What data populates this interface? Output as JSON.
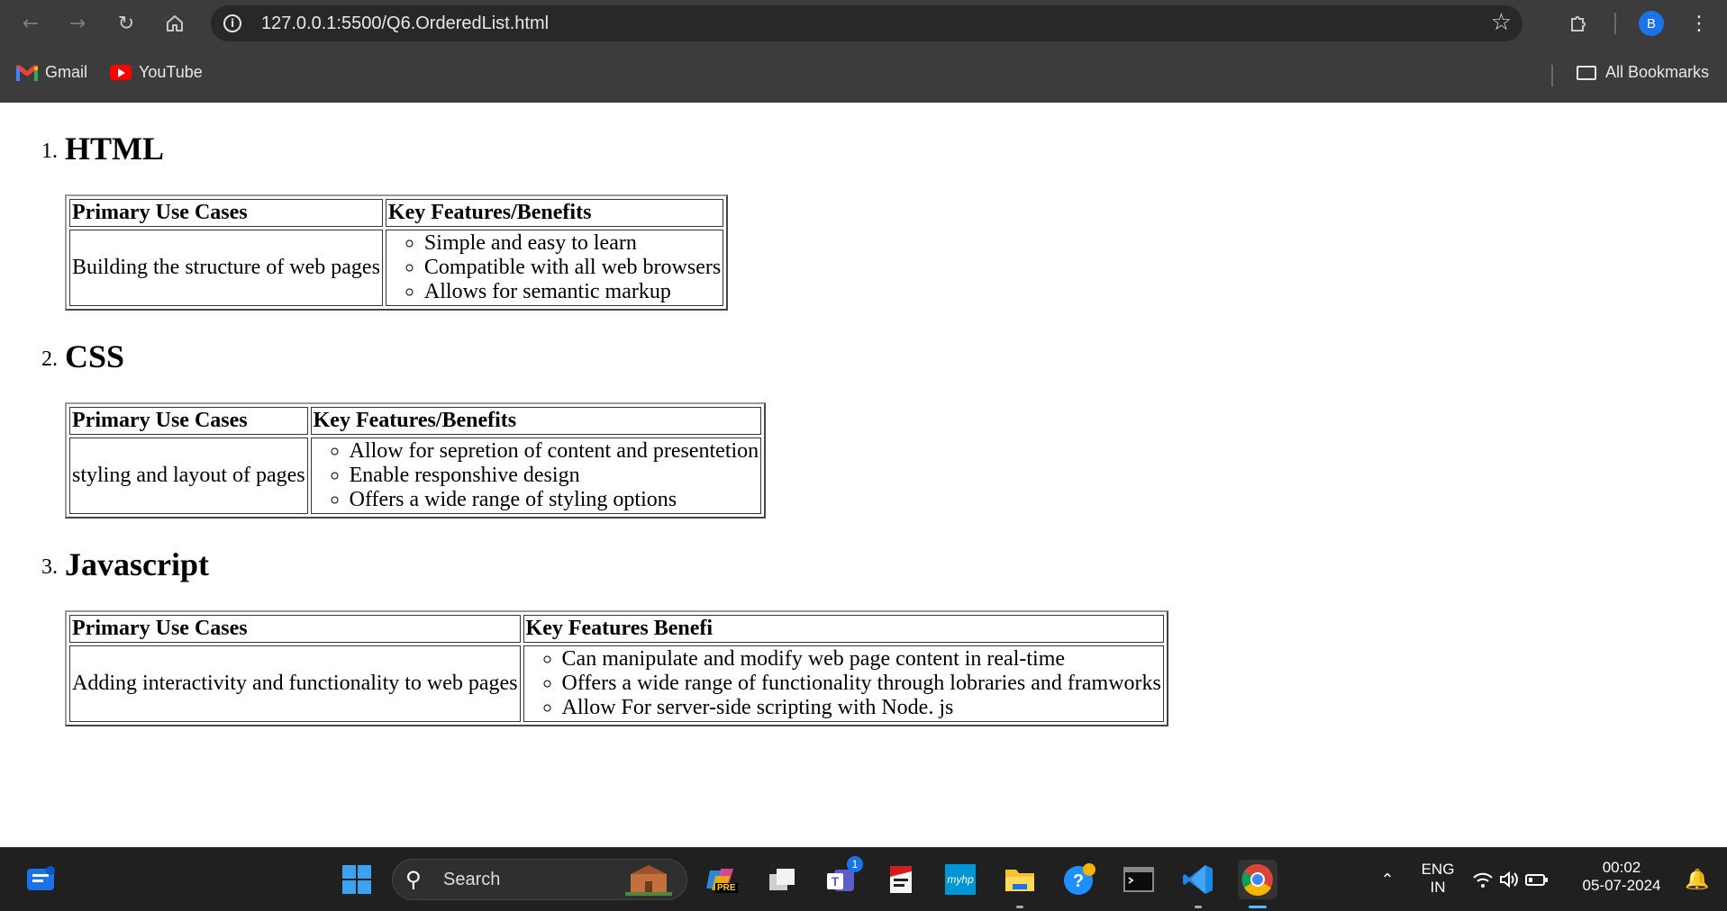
{
  "browser": {
    "url": "127.0.0.1:5500/Q6.OrderedList.html",
    "profile_initial": "B",
    "icons": {
      "back": "back-arrow-icon",
      "forward": "forward-arrow-icon",
      "reload": "reload-icon",
      "home": "home-icon",
      "site_info": "info-icon",
      "star": "star-icon",
      "extensions": "puzzle-icon",
      "menu": "three-dots-icon"
    },
    "bookmarks": [
      {
        "label": "Gmail",
        "icon": "gmail-icon"
      },
      {
        "label": "YouTube",
        "icon": "youtube-icon"
      }
    ],
    "all_bookmarks_label": "All Bookmarks"
  },
  "page": {
    "sections": [
      {
        "number": "1.",
        "title": "HTML",
        "col1_header": "Primary Use Cases",
        "col2_header": "Key Features/Benefits",
        "use_case": "Building the structure of web pages",
        "features": [
          "Simple and easy to learn",
          "Compatible with all web browsers",
          "Allows for semantic markup"
        ]
      },
      {
        "number": "2.",
        "title": "CSS",
        "col1_header": "Primary Use Cases",
        "col2_header": "Key Features/Benefits",
        "use_case": "styling and layout of pages",
        "features": [
          "Allow for sepretion of content and presentetion",
          "Enable responshive design",
          "Offers a wide range of styling options"
        ]
      },
      {
        "number": "3.",
        "title": "Javascript",
        "col1_header": "Primary Use Cases",
        "col2_header": "Key Features Benefi",
        "use_case": "Adding interactivity and functionality to web pages",
        "features": [
          "Can manipulate and modify web page content in real-time",
          "Offers a wide range of functionality through lobraries and framworks",
          "Allow For server-side scripting with Node. js"
        ]
      }
    ]
  },
  "taskbar": {
    "search_label": "Search",
    "language_line1": "ENG",
    "language_line2": "IN",
    "time": "00:02",
    "date": "05-07-2024",
    "teams_badge": "1",
    "copilot_badge": "PRE",
    "myhp_label": "myhp",
    "colors": {
      "accent": "#1a73e8",
      "windows_blue": "#0078d4"
    }
  }
}
